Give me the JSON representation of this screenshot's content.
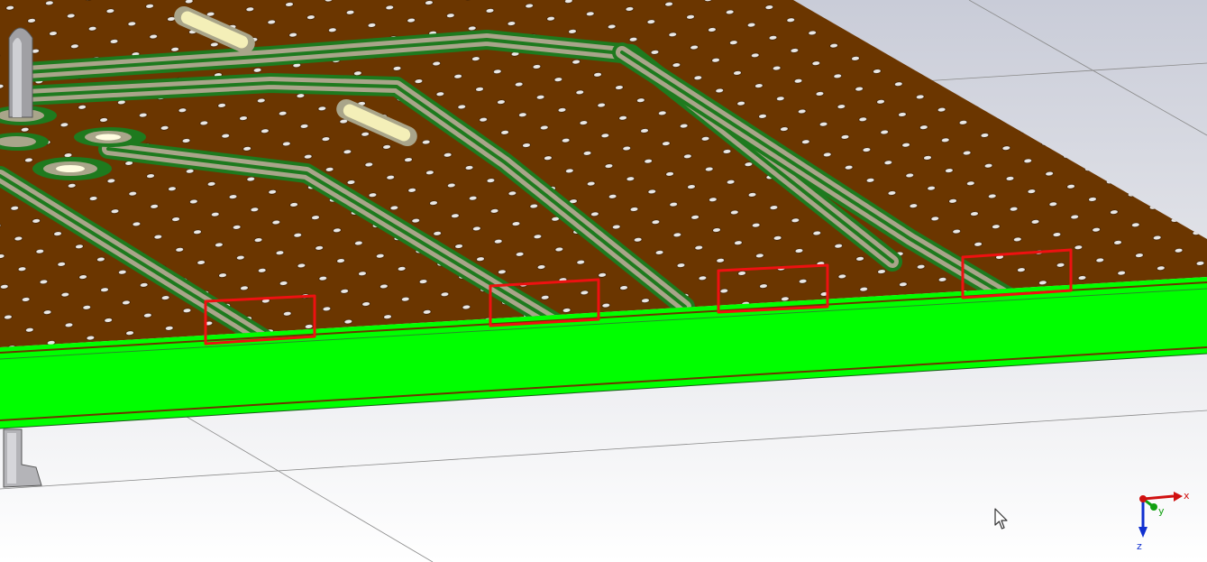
{
  "viewport": {
    "board_color": "#6b3600",
    "trace_green": "#1e7a1e",
    "trace_metal": "#a9a58a",
    "edge_green": "#00ff00",
    "highlight_color": "#ee1111",
    "background_top": "#c9ccd8",
    "background_bottom": "#ffffff"
  },
  "axes": {
    "x_label": "x",
    "y_label": "y",
    "z_label": "z",
    "x_color": "#d01010",
    "y_color": "#10a010",
    "z_color": "#1030d0"
  },
  "icons": {
    "cursor": "arrow-cursor-icon",
    "axis_triad": "axis-triad-icon"
  }
}
